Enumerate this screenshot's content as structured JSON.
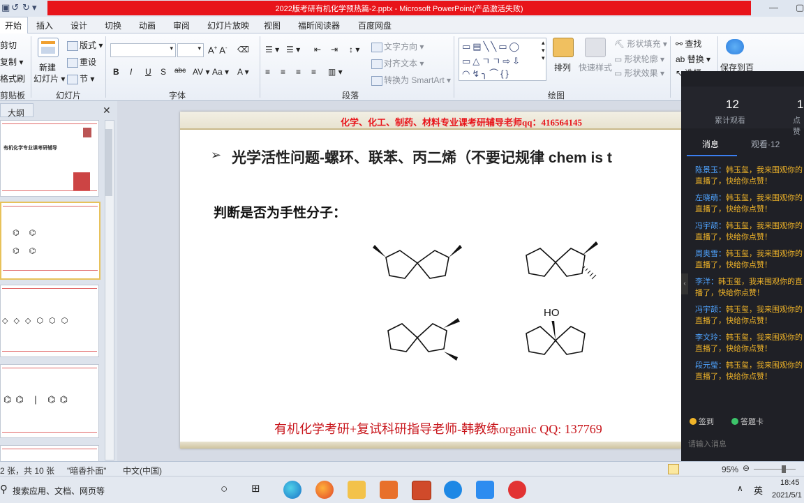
{
  "window": {
    "title": "2022版考研有机化学预热篇-2.pptx  -  Microsoft PowerPoint(产品激活失败)"
  },
  "tabs": [
    "开始",
    "插入",
    "设计",
    "切换",
    "动画",
    "审阅",
    "幻灯片放映",
    "视图",
    "福昕阅读器",
    "百度网盘"
  ],
  "ribbon": {
    "clipboard": {
      "cut": "剪切",
      "copy": "复制",
      "format_painter": "格式刷",
      "group": "剪贴板"
    },
    "slides": {
      "new_slide": "新建",
      "new_slide2": "幻灯片",
      "layout": "版式",
      "reset": "重设",
      "section": "节",
      "group": "幻灯片"
    },
    "font": {
      "group": "字体"
    },
    "paragraph": {
      "text_direction": "文字方向",
      "align_text": "对齐文本",
      "smartart": "转换为 SmartArt",
      "group": "段落"
    },
    "drawing": {
      "arrange": "排列",
      "quick_styles": "快速样式",
      "shape_fill": "形状填充",
      "shape_outline": "形状轮廓",
      "shape_effects": "形状效果",
      "group": "绘图"
    },
    "editing": {
      "find": "查找",
      "replace": "替换",
      "select": "选择"
    },
    "baidu": {
      "save_to": "保存到百"
    }
  },
  "left_pane": {
    "outline_tab": "大纲",
    "thumb1_title": "有机化学专业课考研辅导"
  },
  "slide": {
    "contact": "化学、化工、制药、材料专业课考研辅导老师qq：416564145",
    "bullet": "➢",
    "title": "光学活性问题-螺环、联苯、丙二烯（不要记规律   chem  is  t",
    "question": "判断是否为手性分子：",
    "ho_label": "HO",
    "footer": "有机化学考研+复试科研指导老师-韩教练organic QQ: 137769"
  },
  "chat": {
    "cumulative_views": "12",
    "cumulative_label": "累计观看",
    "likes": "1",
    "likes_label": "点赞",
    "tab_messages": "消息",
    "tab_viewers": "观看·12",
    "messages": [
      {
        "who": "陈景玉：",
        "text": "韩玉玺，我来围观你的直播了，快给你点赞！"
      },
      {
        "who": "左晓萌：",
        "text": "韩玉玺，我来围观你的直播了，快给你点赞！"
      },
      {
        "who": "冯宇颉：",
        "text": "韩玉玺，我来围观你的直播了，快给你点赞！"
      },
      {
        "who": "周奥雪：",
        "text": "韩玉玺，我来围观你的直播了，快给你点赞！"
      },
      {
        "who": "李洋：",
        "text": "韩玉玺，我来围观你的直播了，快给你点赞！"
      },
      {
        "who": "冯宇颉：",
        "text": "韩玉玺，我来围观你的直播了，快给你点赞！"
      },
      {
        "who": "李文玲：",
        "text": "韩玉玺，我来围观你的直播了，快给你点赞！"
      },
      {
        "who": "段元瑩：",
        "text": "韩玉玺，我来围观你的直播了，快给你点赞！"
      }
    ],
    "checkin": "签到",
    "answer_card": "答题卡",
    "input_placeholder": "请输入消息"
  },
  "status": {
    "slide_count": "2 张，共 10 张",
    "theme": "\"暗香扑面\"",
    "language": "中文(中国)",
    "zoom": "95%"
  },
  "taskbar": {
    "search": "搜索应用、文档、网页等",
    "ime": "英",
    "time": "18:45",
    "date": "2021/5/1"
  },
  "colors": {
    "title_red": "#e8141a",
    "chat_bg": "#1f2026",
    "chat_name": "#4fa3ff",
    "chat_text": "#f0b429"
  }
}
